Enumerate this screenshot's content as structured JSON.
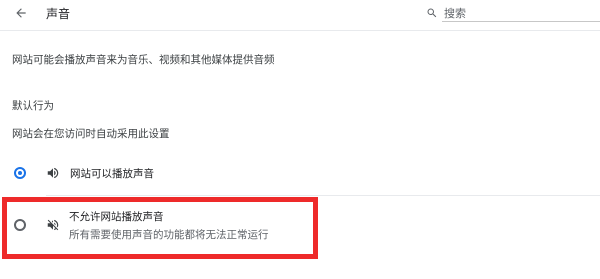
{
  "header": {
    "title": "声音",
    "search_placeholder": "搜索"
  },
  "description": "网站可能会播放声音来为音乐、视频和其他媒体提供音频",
  "default_behavior": {
    "heading": "默认行为",
    "subheading": "网站会在您访问时自动采用此设置"
  },
  "options": [
    {
      "label": "网站可以播放声音",
      "icon": "volume-icon",
      "selected": true
    },
    {
      "label": "不允许网站播放声音",
      "description": "所有需要使用声音的功能都将无法正常运行",
      "icon": "volume-muted-icon",
      "selected": false
    }
  ],
  "colors": {
    "accent": "#1a73e8",
    "highlight": "#ee2a2a"
  }
}
